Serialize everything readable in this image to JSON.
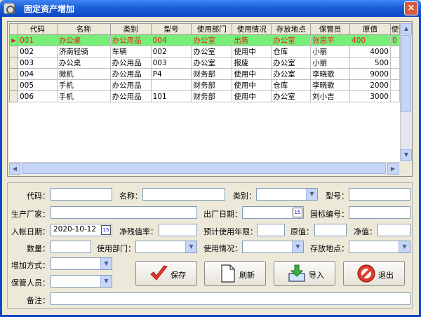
{
  "window": {
    "title": "固定资产增加",
    "close_glyph": "×"
  },
  "grid": {
    "columns": [
      "代码",
      "名称",
      "类别",
      "型号",
      "使用部门",
      "使用情况",
      "存放地点",
      "保管员",
      "原值",
      "使"
    ],
    "rows": [
      {
        "code": "001",
        "name": "办公桌",
        "cat": "办公用品",
        "model": "004",
        "dept": "办公室",
        "status": "出售",
        "loc": "办公室",
        "keeper": "张思平",
        "value": "400",
        "extra": "0"
      },
      {
        "code": "002",
        "name": "济南轻骑",
        "cat": "车辆",
        "model": "002",
        "dept": "办公室",
        "status": "使用中",
        "loc": "仓库",
        "keeper": "小丽",
        "value": "4000",
        "extra": ""
      },
      {
        "code": "003",
        "name": "办公桌",
        "cat": "办公用品",
        "model": "003",
        "dept": "办公室",
        "status": "报废",
        "loc": "办公室",
        "keeper": "小丽",
        "value": "500",
        "extra": ""
      },
      {
        "code": "004",
        "name": "微机",
        "cat": "办公用品",
        "model": "P4",
        "dept": "财务部",
        "status": "使用中",
        "loc": "办公室",
        "keeper": "李晓歌",
        "value": "9000",
        "extra": ""
      },
      {
        "code": "005",
        "name": "手机",
        "cat": "办公用品",
        "model": "",
        "dept": "财务部",
        "status": "使用中",
        "loc": "仓库",
        "keeper": "李晓歌",
        "value": "2000",
        "extra": ""
      },
      {
        "code": "006",
        "name": "手机",
        "cat": "办公用品",
        "model": "101",
        "dept": "财务部",
        "status": "使用中",
        "loc": "办公室",
        "keeper": "刘小吉",
        "value": "3000",
        "extra": ""
      }
    ],
    "selected_row_indicator": "▶"
  },
  "form": {
    "code_label": "代码：",
    "name_label": "名称：",
    "category_label": "类别：",
    "model_label": "型号：",
    "manufacturer_label": "生产厂家：",
    "factory_date_label": "出厂日期：",
    "intl_code_label": "国标编号：",
    "entry_date_label": "入帐日期：",
    "entry_date_value": "2020-10-12",
    "residual_rate_label": "净残值率：",
    "useful_life_label": "预计使用年限：",
    "orig_value_label": "原值：",
    "net_value_label": "净值：",
    "quantity_label": "数量：",
    "dept_label": "使用部门：",
    "usage_label": "使用情况：",
    "location_label": "存放地点：",
    "add_method_label": "增加方式：",
    "keeper_label": "保管人员：",
    "note_label": "备注：",
    "calendar_glyph": "15"
  },
  "buttons": {
    "save": "保存",
    "refresh": "刷新",
    "import": "导入",
    "exit": "退出"
  },
  "colors": {
    "selected_row_bg": "#77ee77",
    "selected_row_text": "#e32020",
    "title_bar": "#1b5fd6"
  }
}
